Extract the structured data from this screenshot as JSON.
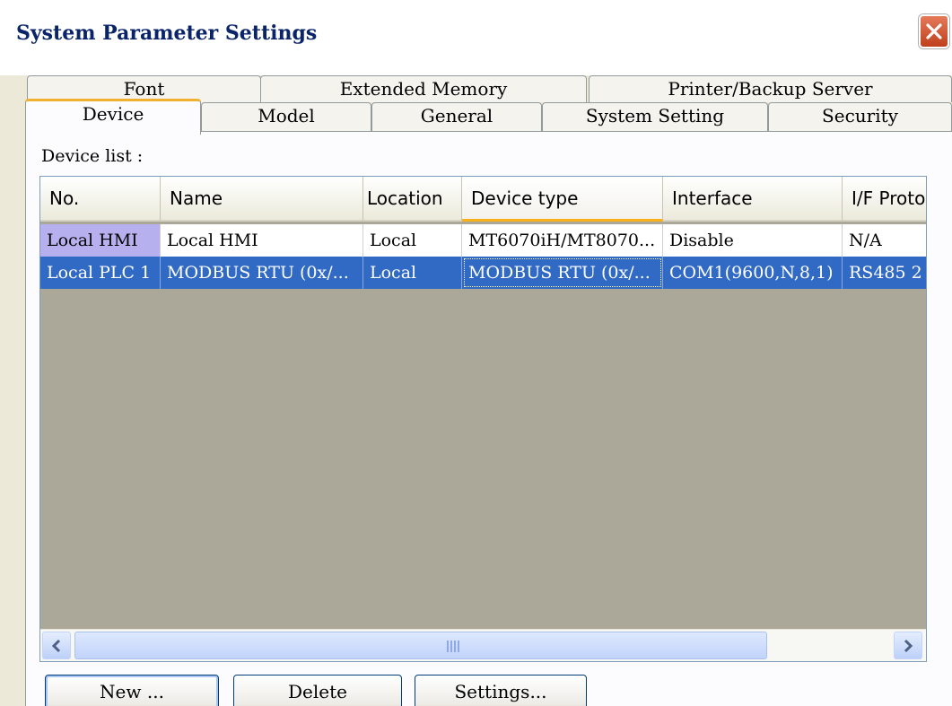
{
  "window": {
    "title": "System Parameter Settings",
    "close_icon": "close-icon"
  },
  "tabs": {
    "back_row": [
      "Font",
      "Extended Memory",
      "Printer/Backup Server"
    ],
    "front_row": [
      "Device",
      "Model",
      "General",
      "System Setting",
      "Security"
    ],
    "active": "Device"
  },
  "device_list": {
    "label": "Device list :",
    "columns": [
      "No.",
      "Name",
      "Location",
      "Device type",
      "Interface",
      "I/F Proto"
    ],
    "rows": [
      [
        "Local HMI",
        "Local HMI",
        "Local",
        "MT6070iH/MT8070...",
        "Disable",
        "N/A"
      ],
      [
        "Local PLC 1",
        "MODBUS RTU (0x/...",
        "Local",
        "MODBUS RTU (0x/...",
        "COM1(9600,N,8,1)",
        "RS485 2"
      ]
    ],
    "selected_row": 1,
    "scrollbar": {
      "left_arrow": "arrow-left-icon",
      "right_arrow": "arrow-right-icon"
    }
  },
  "buttons": {
    "new": "New ...",
    "delete": "Delete",
    "settings": "Settings..."
  },
  "colors": {
    "selection": "#316ac5",
    "accent": "#f0b030",
    "title": "#0a246a"
  }
}
